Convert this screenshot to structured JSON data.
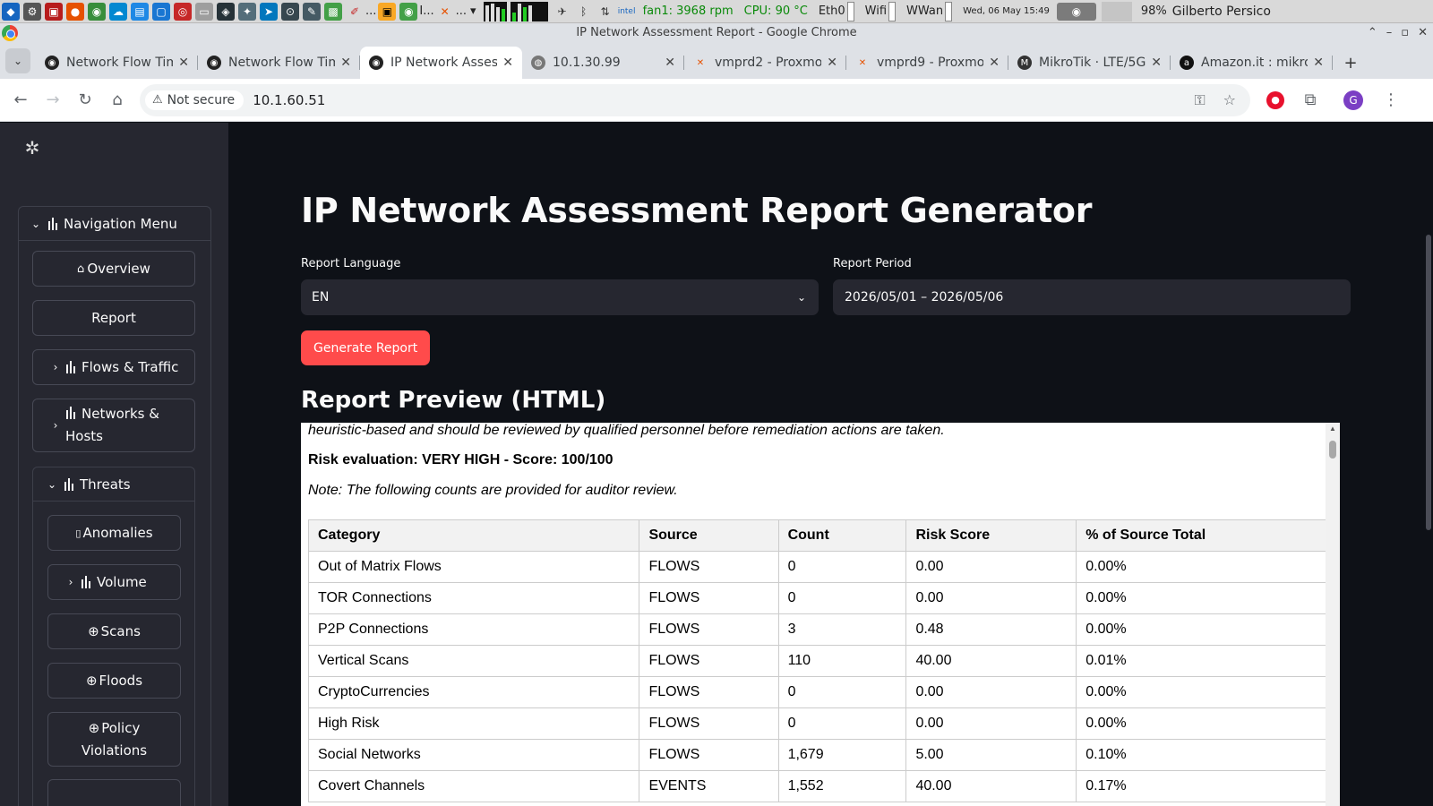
{
  "os_panel": {
    "launcher_dots": "I...",
    "launcher_dots_2": "...",
    "fan": "fan1: 3968 rpm",
    "cpu": "CPU: 90 °C",
    "net_eth": "Eth0",
    "net_wifi": "Wifi",
    "net_wwan": "WWan",
    "clock": "Wed, 06 May  15:49",
    "battery": "98%",
    "user": "Gilberto Persico"
  },
  "window": {
    "title": "IP Network Assessment Report - Google Chrome"
  },
  "tabs": [
    {
      "label": "Network Flow Tim",
      "icon": "app-icon",
      "active": false
    },
    {
      "label": "Network Flow Tim",
      "icon": "app-icon",
      "active": false
    },
    {
      "label": "IP Network Asses",
      "icon": "app-icon",
      "active": true
    },
    {
      "label": "10.1.30.99",
      "icon": "globe-icon",
      "active": false
    },
    {
      "label": "vmprd2 - Proxmo",
      "icon": "proxmox-icon",
      "active": false
    },
    {
      "label": "vmprd9 - Proxmo",
      "icon": "proxmox-icon",
      "active": false
    },
    {
      "label": "MikroTik · LTE/5G",
      "icon": "mikrotik-icon",
      "active": false
    },
    {
      "label": "Amazon.it : mikro",
      "icon": "amazon-icon",
      "active": false
    }
  ],
  "toolbar": {
    "security_label": "Not secure",
    "url": "10.1.60.51",
    "profile_initial": "G"
  },
  "sidebar": {
    "nav_menu_label": "Navigation Menu",
    "overview_label": "Overview",
    "report_label": "Report",
    "flows_label": "Flows & Traffic",
    "networks_label_1": "Networks &",
    "networks_label_2": "Hosts",
    "threats_label": "Threats",
    "anomalies_label": "Anomalies",
    "volume_label": "Volume",
    "scans_label": "Scans",
    "floods_label": "Floods",
    "policy_label_1": "Policy",
    "policy_label_2": "Violations"
  },
  "main": {
    "title": "IP Network Assessment Report Generator",
    "language_label": "Report Language",
    "language_value": "EN",
    "period_label": "Report Period",
    "period_value": "2026/05/01 – 2026/05/06",
    "generate_label": "Generate Report",
    "preview_title": "Report Preview (HTML)"
  },
  "preview": {
    "intro_line": "heuristic-based and should be reviewed by qualified personnel before remediation actions are taken.",
    "risk_line": "Risk evaluation: VERY HIGH - Score: 100/100",
    "note_line": "Note: The following counts are provided for auditor review.",
    "table": {
      "headers": [
        "Category",
        "Source",
        "Count",
        "Risk Score",
        "% of Source Total"
      ],
      "rows": [
        [
          "Out of Matrix Flows",
          "FLOWS",
          "0",
          "0.00",
          "0.00%"
        ],
        [
          "TOR Connections",
          "FLOWS",
          "0",
          "0.00",
          "0.00%"
        ],
        [
          "P2P Connections",
          "FLOWS",
          "3",
          "0.48",
          "0.00%"
        ],
        [
          "Vertical Scans",
          "FLOWS",
          "110",
          "40.00",
          "0.01%"
        ],
        [
          "CryptoCurrencies",
          "FLOWS",
          "0",
          "0.00",
          "0.00%"
        ],
        [
          "High Risk",
          "FLOWS",
          "0",
          "0.00",
          "0.00%"
        ],
        [
          "Social Networks",
          "FLOWS",
          "1,679",
          "5.00",
          "0.10%"
        ],
        [
          "Covert Channels",
          "EVENTS",
          "1,552",
          "40.00",
          "0.17%"
        ]
      ]
    }
  },
  "colors": {
    "app_bg": "#0e1117",
    "sidebar_bg": "#262730",
    "accent": "#ff4b4b",
    "text": "#fafafa"
  }
}
